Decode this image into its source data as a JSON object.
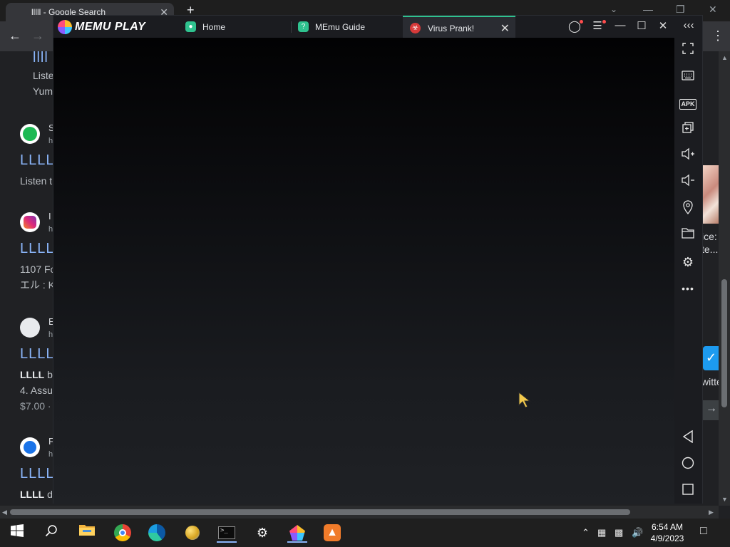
{
  "chrome": {
    "tab_title": "lllll - Google Search",
    "newtab": "+",
    "close_glyph": "✕",
    "results": [
      {
        "site": "",
        "url": "",
        "link": "llll",
        "snippet1": "Liste",
        "snippet2": "Yum"
      },
      {
        "site": "S",
        "url": "h",
        "link": "LLLL",
        "snippet1": "Listen t"
      },
      {
        "site": "I",
        "url": "h",
        "link": "LLLL",
        "snippet1": "1107 Fo",
        "snippet2": "エル : K"
      },
      {
        "site": "E",
        "url": "h",
        "link": "LLLL",
        "snippet_bold": "LLLL",
        "snippet_rest": " b",
        "snippet2": "4. Assu",
        "price": "$7.00 ·"
      },
      {
        "site": "F",
        "url": "h",
        "link": "LLLL",
        "snippet_bold": "LLLL",
        "snippet_rest": " d"
      }
    ],
    "side_text1": "ice:",
    "side_text2": "te...",
    "side_text3": "witte"
  },
  "memu": {
    "brand": "MEMU PLAY",
    "tabs": [
      {
        "label": "Home"
      },
      {
        "label": "MEmu Guide"
      },
      {
        "label": "Virus Prank!"
      }
    ],
    "sidebar_icons": [
      "fullscreen-icon",
      "keyboard-icon",
      "apk-icon",
      "multi-window-icon",
      "volume-up-icon",
      "volume-down-icon",
      "location-icon",
      "folder-icon",
      "settings-icon",
      "more-icon",
      "back-icon",
      "home-icon",
      "recents-icon"
    ],
    "apk_label": "APK"
  },
  "taskbar": {
    "time": "6:54 AM",
    "date": "4/9/2023"
  },
  "colors": {
    "memu_accent": "#2fc28f",
    "link_blue": "#8ab4f8",
    "twitter_blue": "#1d9bf0"
  }
}
